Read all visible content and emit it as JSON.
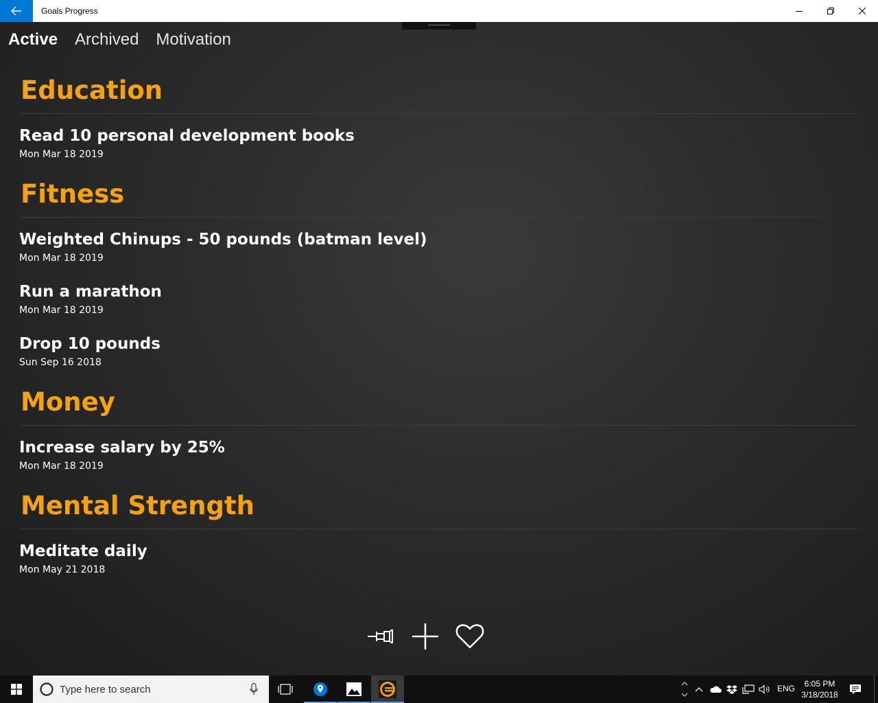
{
  "window": {
    "title": "Goals Progress"
  },
  "tabs": [
    {
      "label": "Active",
      "active": true
    },
    {
      "label": "Archived",
      "active": false
    },
    {
      "label": "Motivation",
      "active": false
    }
  ],
  "categories": [
    {
      "title": "Education",
      "goals": [
        {
          "title": "Read 10 personal development books",
          "date": "Mon Mar 18 2019"
        }
      ]
    },
    {
      "title": "Fitness",
      "goals": [
        {
          "title": "Weighted Chinups - 50 pounds (batman level)",
          "date": "Mon Mar 18 2019"
        },
        {
          "title": "Run a marathon",
          "date": "Mon Mar 18 2019"
        },
        {
          "title": "Drop 10 pounds",
          "date": "Sun Sep 16 2018"
        }
      ]
    },
    {
      "title": "Money",
      "goals": [
        {
          "title": "Increase salary by 25%",
          "date": "Mon Mar 18 2019"
        }
      ]
    },
    {
      "title": "Mental Strength",
      "goals": [
        {
          "title": "Meditate daily",
          "date": "Mon May 21 2018"
        }
      ]
    }
  ],
  "commands": {
    "icons": [
      "pin-icon",
      "add-icon",
      "heart-icon"
    ]
  },
  "taskbar": {
    "search_placeholder": "Type here to search",
    "language": "ENG",
    "time": "6:05 PM",
    "date": "3/18/2018"
  },
  "colors": {
    "accent": "#f5a20c",
    "titlebar_back": "#0078d7",
    "text": "#ffffff"
  }
}
